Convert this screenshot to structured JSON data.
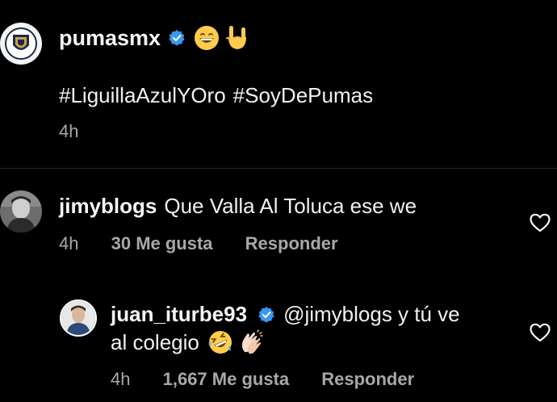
{
  "post": {
    "username": "pumasmx",
    "verified": true,
    "emojis": [
      "grinning-face-emoji",
      "sign-of-horns-emoji"
    ],
    "hashtags": [
      "#LiguillaAzulYOro",
      "#SoyDePumas"
    ],
    "time": "4h"
  },
  "comments": [
    {
      "username": "jimyblogs",
      "text": "Que Valla Al Toluca ese we",
      "time": "4h",
      "likes": "30 Me gusta",
      "reply_label": "Responder"
    }
  ],
  "replies": [
    {
      "username": "juan_iturbe93",
      "verified": true,
      "mention": "@jimyblogs",
      "text_line1": " y tú ve",
      "text_line2": "al colegio",
      "emojis": [
        "rolling-laughing-emoji",
        "clapping-hands-emoji"
      ],
      "time": "4h",
      "likes": "1,667 Me gusta",
      "reply_label": "Responder"
    }
  ],
  "colors": {
    "background": "#000000",
    "text": "#f5f5f5",
    "muted": "#a8a8a8",
    "verified": "#3897f0",
    "pumas_gold": "#c8a14a",
    "pumas_blue": "#1b2a4a"
  },
  "icons": [
    "verified-badge-icon",
    "heart-outline-icon"
  ]
}
